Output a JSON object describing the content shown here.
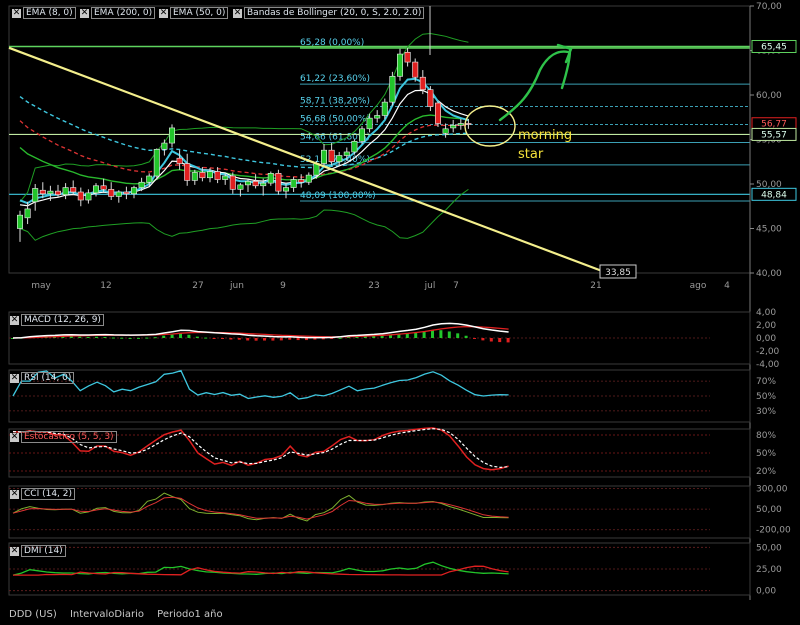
{
  "window": {
    "symbol": "DDD (US)",
    "interval": "IntervaloDiario",
    "period": "Periodo1 año"
  },
  "main_chart": {
    "indicators": [
      "EMA (8, 0)",
      "EMA (200, 0)",
      "EMA (50, 0)",
      "Bandas de Bollinger (20, 0, S, 2.0, 2.0)"
    ],
    "y_axis": {
      "ticks": [
        "70,00",
        "65,00",
        "60,00",
        "55,00",
        "50,00",
        "45,00",
        "40,00"
      ],
      "ylim": [
        40,
        70
      ]
    },
    "x_axis": {
      "ticks": [
        "may",
        "12",
        "27",
        "jun",
        "9",
        "23",
        "jul",
        "7",
        "21",
        "ago",
        "4"
      ]
    },
    "fib_levels": [
      {
        "label": "65,28  (0,00%)",
        "value": 65.28
      },
      {
        "label": "61,22  (23,60%)",
        "value": 61.22
      },
      {
        "label": "58,71  (38,20%)",
        "value": 58.71
      },
      {
        "label": "56,68  (50,00%)",
        "value": 56.68
      },
      {
        "label": "54,66  (61,80%)",
        "value": 54.66
      },
      {
        "label": "52,15  (76,40%)",
        "value": 52.15
      },
      {
        "label": "48,09  (100,00%)",
        "value": 48.09
      }
    ],
    "price_labels": {
      "top_line": "65,45",
      "last": "56,77",
      "support": "55,57",
      "lower": "48,84",
      "trend_end": "33,85"
    },
    "annotation": {
      "line1": "morning",
      "line2": "star"
    },
    "colors": {
      "up": "#22c52a",
      "down": "#e02020",
      "ema8": "#ffffff",
      "ema50": "#29b82d",
      "ema200": "#3ec7df",
      "bollinger": "#1f9f24",
      "trend": "#f4ef8c",
      "fib": "#4fd6f0"
    }
  },
  "macd": {
    "label": "MACD (12, 26, 9)",
    "ticks": [
      "4,00",
      "2,00",
      "0,00",
      "-2,00",
      "-4,00"
    ]
  },
  "rsi": {
    "label": "RSI (14, 0)",
    "ticks": [
      "70%",
      "50%",
      "30%"
    ]
  },
  "stoch": {
    "label": "Estocástico (5, 5, 3)",
    "ticks": [
      "80%",
      "50%",
      "20%"
    ]
  },
  "cci": {
    "label": "CCI (14, 2)",
    "ticks": [
      "300,00",
      "50,00",
      "-200,00"
    ]
  },
  "dmi": {
    "label": "DMI (14)",
    "ticks": [
      "50,00",
      "25,00",
      "0,00"
    ]
  },
  "chart_data": {
    "type": "line",
    "candles": [
      {
        "o": 45,
        "h": 47,
        "l": 43.5,
        "c": 46.5
      },
      {
        "o": 46.2,
        "h": 48,
        "l": 45.5,
        "c": 47.2
      },
      {
        "o": 48,
        "h": 50,
        "l": 47,
        "c": 49.5
      },
      {
        "o": 49.3,
        "h": 50.2,
        "l": 48.4,
        "c": 48.9
      },
      {
        "o": 48.9,
        "h": 49.8,
        "l": 48.1,
        "c": 49.2
      },
      {
        "o": 49.2,
        "h": 49.9,
        "l": 48.5,
        "c": 48.8
      },
      {
        "o": 48.8,
        "h": 50.1,
        "l": 48.3,
        "c": 49.6
      },
      {
        "o": 49.6,
        "h": 50.4,
        "l": 48.8,
        "c": 49.1
      },
      {
        "o": 49.1,
        "h": 49.6,
        "l": 47.5,
        "c": 48.2
      },
      {
        "o": 48.2,
        "h": 49.4,
        "l": 47.8,
        "c": 49
      },
      {
        "o": 49,
        "h": 50.1,
        "l": 48.6,
        "c": 49.8
      },
      {
        "o": 49.8,
        "h": 50.6,
        "l": 49.1,
        "c": 49.4
      },
      {
        "o": 49.4,
        "h": 50.2,
        "l": 48.2,
        "c": 48.6
      },
      {
        "o": 48.6,
        "h": 49.3,
        "l": 47.9,
        "c": 49.1
      },
      {
        "o": 49.1,
        "h": 49.7,
        "l": 48.3,
        "c": 48.9
      },
      {
        "o": 48.9,
        "h": 49.8,
        "l": 48.4,
        "c": 49.6
      },
      {
        "o": 49.6,
        "h": 50.7,
        "l": 49.2,
        "c": 50.2
      },
      {
        "o": 50.2,
        "h": 51.2,
        "l": 49.8,
        "c": 50.9
      },
      {
        "o": 50.9,
        "h": 54,
        "l": 50.5,
        "c": 53.9
      },
      {
        "o": 53.9,
        "h": 55,
        "l": 53.2,
        "c": 54.6
      },
      {
        "o": 54.6,
        "h": 56.7,
        "l": 54.1,
        "c": 56.3
      },
      {
        "o": 52.9,
        "h": 53.8,
        "l": 51.6,
        "c": 52.3
      },
      {
        "o": 52.3,
        "h": 53.4,
        "l": 49.8,
        "c": 50.4
      },
      {
        "o": 50.4,
        "h": 51.6,
        "l": 49.9,
        "c": 51.3
      },
      {
        "o": 51.3,
        "h": 51.9,
        "l": 50.3,
        "c": 50.7
      },
      {
        "o": 50.7,
        "h": 51.8,
        "l": 50.2,
        "c": 51.4
      },
      {
        "o": 51.4,
        "h": 51.9,
        "l": 50.1,
        "c": 50.5
      },
      {
        "o": 50.5,
        "h": 51.2,
        "l": 49.9,
        "c": 50.9
      },
      {
        "o": 50.9,
        "h": 51.3,
        "l": 48.9,
        "c": 49.4
      },
      {
        "o": 49.4,
        "h": 50.1,
        "l": 48.6,
        "c": 49.9
      },
      {
        "o": 49.9,
        "h": 50.6,
        "l": 49.1,
        "c": 50.3
      },
      {
        "o": 50.3,
        "h": 51.1,
        "l": 49.5,
        "c": 49.8
      },
      {
        "o": 49.8,
        "h": 50.6,
        "l": 48.7,
        "c": 50.1
      },
      {
        "o": 50.1,
        "h": 51.4,
        "l": 49.8,
        "c": 51.2
      },
      {
        "o": 51.2,
        "h": 51.6,
        "l": 48.8,
        "c": 49.2
      },
      {
        "o": 49.2,
        "h": 50.1,
        "l": 48.4,
        "c": 49.6
      },
      {
        "o": 49.6,
        "h": 50.8,
        "l": 49.1,
        "c": 50.5
      },
      {
        "o": 50.5,
        "h": 51.1,
        "l": 49.6,
        "c": 50.2
      },
      {
        "o": 50.2,
        "h": 51.3,
        "l": 49.9,
        "c": 51
      },
      {
        "o": 51,
        "h": 52.6,
        "l": 50.6,
        "c": 52.3
      },
      {
        "o": 52.3,
        "h": 54.5,
        "l": 52,
        "c": 53.8
      },
      {
        "o": 53.8,
        "h": 54.6,
        "l": 52.1,
        "c": 52.5
      },
      {
        "o": 52.5,
        "h": 53.6,
        "l": 52,
        "c": 53.2
      },
      {
        "o": 53.2,
        "h": 54.1,
        "l": 52.6,
        "c": 53.6
      },
      {
        "o": 53.6,
        "h": 55,
        "l": 53.3,
        "c": 54.8
      },
      {
        "o": 54.8,
        "h": 56.5,
        "l": 54.5,
        "c": 56.2
      },
      {
        "o": 56.2,
        "h": 57.9,
        "l": 55.8,
        "c": 57.4
      },
      {
        "o": 57.4,
        "h": 58.3,
        "l": 56.9,
        "c": 57.7
      },
      {
        "o": 57.7,
        "h": 59.6,
        "l": 57.3,
        "c": 59.2
      },
      {
        "o": 59.2,
        "h": 62.6,
        "l": 58.8,
        "c": 62.1
      },
      {
        "o": 62.1,
        "h": 65.2,
        "l": 61.6,
        "c": 64.6
      },
      {
        "o": 64.8,
        "h": 65.3,
        "l": 63.2,
        "c": 63.7
      },
      {
        "o": 63.7,
        "h": 64.1,
        "l": 61.5,
        "c": 62
      },
      {
        "o": 62,
        "h": 62.8,
        "l": 60.1,
        "c": 60.6
      },
      {
        "o": 60.6,
        "h": 61,
        "l": 58.2,
        "c": 58.7
      },
      {
        "o": 59.1,
        "h": 59.3,
        "l": 56.4,
        "c": 56.8
      },
      {
        "o": 55.7,
        "h": 56.8,
        "l": 55.2,
        "c": 56.2
      },
      {
        "o": 56.3,
        "h": 57.2,
        "l": 55.8,
        "c": 56.6
      },
      {
        "o": 56.6,
        "h": 57.3,
        "l": 56.1,
        "c": 56.8
      },
      {
        "o": 56.8,
        "h": 57.3,
        "l": 56.2,
        "c": 56.7
      }
    ],
    "x_start": "2013-04-29",
    "trendline": {
      "from": [
        0,
        65.3
      ],
      "to": [
        59,
        40.6
      ]
    }
  }
}
